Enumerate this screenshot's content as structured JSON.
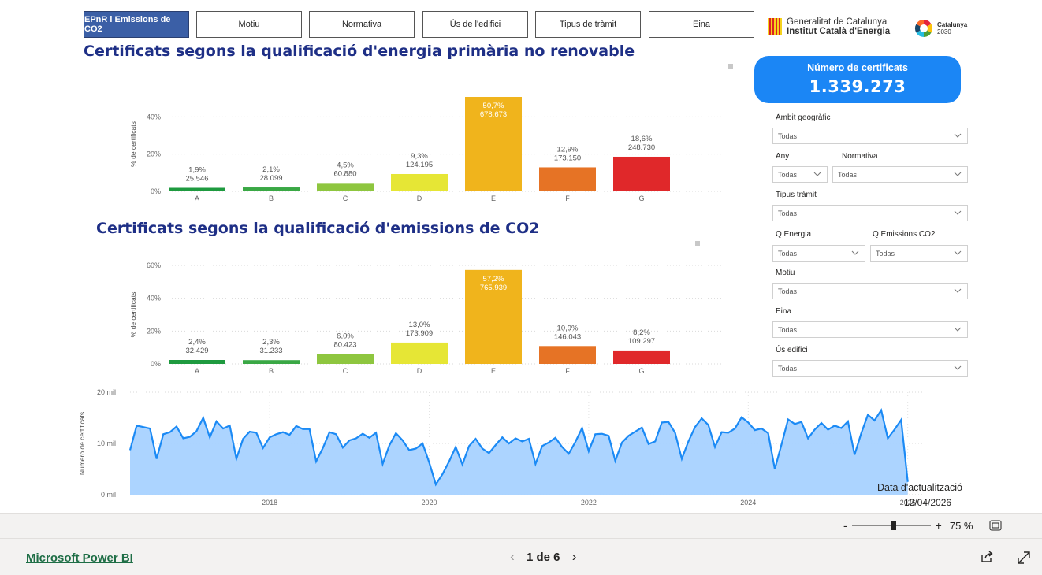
{
  "tabs": [
    {
      "label": "EPnR i Emissions de CO2",
      "active": true
    },
    {
      "label": "Motiu",
      "active": false
    },
    {
      "label": "Normativa",
      "active": false
    },
    {
      "label": "Ús de l'edifici",
      "active": false
    },
    {
      "label": "Tipus de tràmit",
      "active": false
    },
    {
      "label": "Eina",
      "active": false
    }
  ],
  "logos": {
    "gencat_line1": "Generalitat de Catalunya",
    "gencat_line2": "Institut Català d'Energia",
    "catalunya_line1": "Catalunya",
    "catalunya_line2": "2030"
  },
  "titles": {
    "chart1": "Certificats segons la qualificació d'energia primària no renovable",
    "chart2": "Certificats segons la qualificació d'emissions de CO2"
  },
  "card": {
    "label": "Número de certificats",
    "value": "1.339.273"
  },
  "filters": {
    "ambit": {
      "label": "Àmbit geogràfic",
      "value": "Todas"
    },
    "any": {
      "label": "Any",
      "value": "Todas"
    },
    "normativa": {
      "label": "Normativa",
      "value": "Todas"
    },
    "tramit": {
      "label": "Tipus tràmit",
      "value": "Todas"
    },
    "qenergia": {
      "label": "Q Energia",
      "value": "Todas"
    },
    "qemissions": {
      "label": "Q Emissions CO2",
      "value": "Todas"
    },
    "motiu": {
      "label": "Motiu",
      "value": "Todas"
    },
    "eina": {
      "label": "Eina",
      "value": "Todas"
    },
    "us": {
      "label": "Ús edifici",
      "value": "Todas"
    }
  },
  "update": {
    "label": "Data d'actualització",
    "date": "12/04/2026"
  },
  "footer": {
    "link": "Microsoft Power BI",
    "page": "1 de 6",
    "zoom": "75 %"
  },
  "colors": {
    "A": "#1e9a3f",
    "B": "#3aa845",
    "C": "#8ec63f",
    "D": "#e6e635",
    "E": "#f0b41c",
    "F": "#e67325",
    "G": "#e0282a",
    "area": "#a8d2ff",
    "line": "#1b8af5"
  },
  "chart_data": [
    {
      "type": "bar",
      "title": "Certificats segons la qualificació d'energia primària no renovable",
      "ylabel": "% de certificats",
      "categories": [
        "A",
        "B",
        "C",
        "D",
        "E",
        "F",
        "G"
      ],
      "values": [
        1.9,
        2.1,
        4.5,
        9.3,
        50.7,
        12.9,
        18.6
      ],
      "counts": [
        "25.546",
        "28.099",
        "60.880",
        "124.195",
        "678.673",
        "173.150",
        "248.730"
      ],
      "pct_labels": [
        "1,9%",
        "2,1%",
        "4,5%",
        "9,3%",
        "50,7%",
        "12,9%",
        "18,6%"
      ],
      "yticks": [
        "0%",
        "20%",
        "40%"
      ],
      "ylim": [
        0,
        50.7
      ]
    },
    {
      "type": "bar",
      "title": "Certificats segons la qualificació d'emissions de CO2",
      "ylabel": "% de certificats",
      "categories": [
        "A",
        "B",
        "C",
        "D",
        "E",
        "F",
        "G"
      ],
      "values": [
        2.4,
        2.3,
        6.0,
        13.0,
        57.2,
        10.9,
        8.2
      ],
      "counts": [
        "32.429",
        "31.233",
        "80.423",
        "173.909",
        "765.939",
        "146.043",
        "109.297"
      ],
      "pct_labels": [
        "2,4%",
        "2,3%",
        "6,0%",
        "13,0%",
        "57,2%",
        "10,9%",
        "8,2%"
      ],
      "yticks": [
        "0%",
        "20%",
        "40%",
        "60%"
      ],
      "ylim": [
        0,
        60
      ]
    },
    {
      "type": "area",
      "ylabel": "Número de certificats",
      "yticks": [
        "0 mil",
        "10 mil",
        "20 mil"
      ],
      "xticks": [
        "2018",
        "2020",
        "2022",
        "2024",
        "2026"
      ],
      "xlim": [
        2016.25,
        2026.25
      ],
      "ylim": [
        0,
        20000
      ],
      "x_start": "2016-04",
      "x_step": "month",
      "values": [
        8700,
        13500,
        13200,
        12900,
        7000,
        11800,
        12200,
        13300,
        11000,
        11300,
        12400,
        15000,
        11200,
        14300,
        12900,
        13500,
        7000,
        10900,
        12300,
        12100,
        9100,
        11200,
        11800,
        12200,
        11700,
        13400,
        12800,
        12800,
        6500,
        9100,
        12200,
        11800,
        9200,
        10600,
        11000,
        11900,
        11100,
        12100,
        6000,
        9600,
        12000,
        10600,
        8700,
        9000,
        10000,
        6300,
        2000,
        4000,
        6500,
        9300,
        5900,
        9500,
        10900,
        9000,
        8100,
        9700,
        11200,
        10000,
        11000,
        10400,
        10900,
        6000,
        9500,
        10200,
        11100,
        9300,
        8000,
        10300,
        13000,
        8500,
        11800,
        11900,
        11500,
        6600,
        10200,
        11500,
        12300,
        13100,
        9900,
        10400,
        14100,
        14200,
        12100,
        7000,
        10400,
        13200,
        14900,
        13600,
        9300,
        12200,
        12100,
        12900,
        15100,
        14100,
        12600,
        12900,
        12000,
        5000,
        9800,
        14700,
        13800,
        14200,
        11000,
        12700,
        14000,
        12700,
        13500,
        13000,
        14300,
        7800,
        12000,
        15600,
        14500,
        16500,
        11000,
        12700,
        14600,
        2500
      ]
    }
  ]
}
